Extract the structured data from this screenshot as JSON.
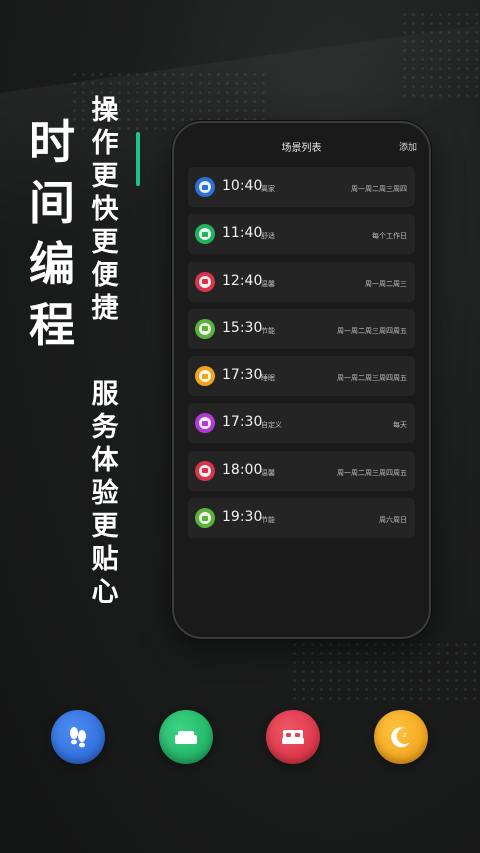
{
  "headline": [
    "时",
    "间",
    "编",
    "程"
  ],
  "slogan_1": [
    "操",
    "作",
    "更",
    "快",
    "更",
    "便",
    "捷"
  ],
  "slogan_2": [
    "服",
    "务",
    "体",
    "验",
    "更",
    "贴",
    "心"
  ],
  "phone": {
    "title": "场景列表",
    "add_label": "添加",
    "scenes": [
      {
        "time": "10:40",
        "label": "离家",
        "days": "周一周二周三周四",
        "color": "#2f6fdc",
        "icon": "footprints-icon"
      },
      {
        "time": "11:40",
        "label": "舒适",
        "days": "每个工作日",
        "color": "#22b35c",
        "icon": "sofa-icon"
      },
      {
        "time": "12:40",
        "label": "温馨",
        "days": "周一周二周三",
        "color": "#d8344a",
        "icon": "bed-icon"
      },
      {
        "time": "15:30",
        "label": "节能",
        "days": "周一周二周三周四周五",
        "color": "#5ab33a",
        "icon": "leaf-icon"
      },
      {
        "time": "17:30",
        "label": "睡眠",
        "days": "周一周二周三周四周五",
        "color": "#f0a31c",
        "icon": "moon-icon"
      },
      {
        "time": "17:30",
        "label": "自定义",
        "days": "每天",
        "color": "#b43ad6",
        "icon": "custom-icon"
      },
      {
        "time": "18:00",
        "label": "温馨",
        "days": "周一周二周三周四周五",
        "color": "#d8344a",
        "icon": "bed-icon"
      },
      {
        "time": "19:30",
        "label": "节能",
        "days": "周六周日",
        "color": "#5ab33a",
        "icon": "leaf-icon"
      }
    ]
  },
  "bottom_icons": [
    {
      "name": "footprints-icon",
      "color": "#2563d6",
      "color2": "#4c8cf0"
    },
    {
      "name": "sofa-icon",
      "color": "#14a75a",
      "color2": "#3fd384"
    },
    {
      "name": "bed-icon",
      "color": "#d32a3c",
      "color2": "#f05566"
    },
    {
      "name": "moon-icon",
      "color": "#ee9a12",
      "color2": "#ffc23e"
    }
  ]
}
